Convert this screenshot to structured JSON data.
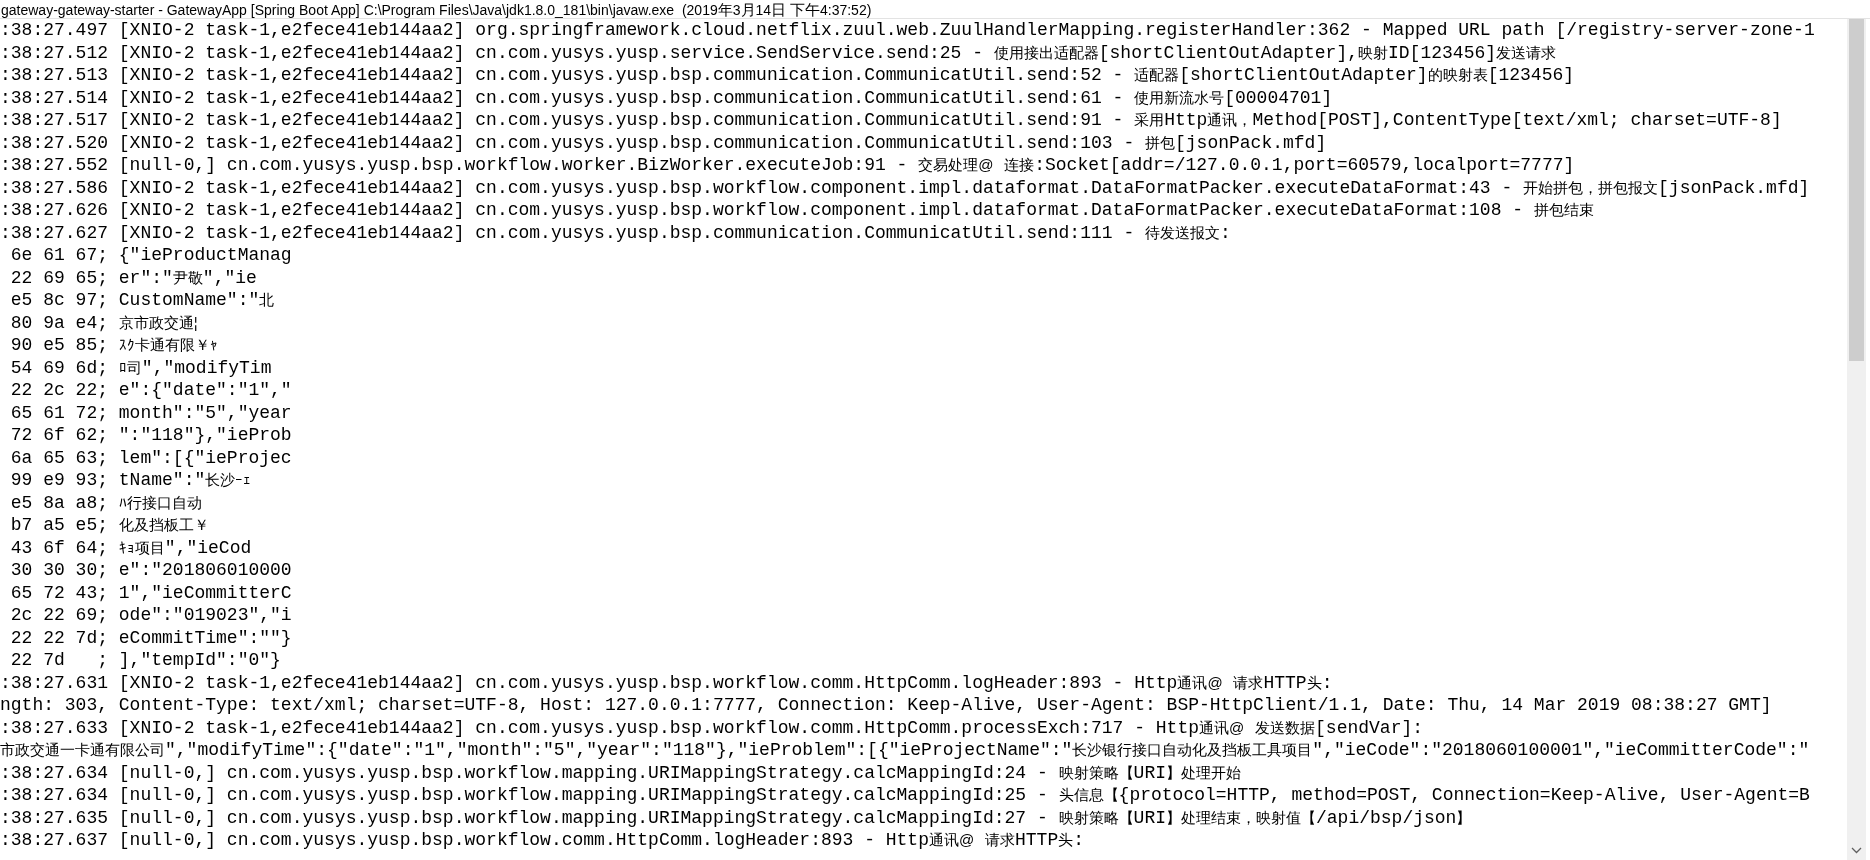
{
  "window": {
    "title": "gateway-gateway-starter - GatewayApp [Spring Boot App] C:\\Program Files\\Java\\jdk1.8.0_181\\bin\\javaw.exe  (2019年3月14日 下午4:37:52)"
  },
  "console": {
    "lines": [
      ":38:27.497 [XNIO-2 task-1,e2fece41eb144aa2] org.springframework.cloud.netflix.zuul.web.ZuulHandlerMapping.registerHandler:362 - Mapped URL path [/registry-server-zone-1",
      ":38:27.512 [XNIO-2 task-1,e2fece41eb144aa2] cn.com.yusys.yusp.service.SendService.send:25 - 使用接出适配器[shortClientOutAdapter],映射ID[123456]发送请求",
      ":38:27.513 [XNIO-2 task-1,e2fece41eb144aa2] cn.com.yusys.yusp.bsp.communication.CommunicatUtil.send:52 - 适配器[shortClientOutAdapter]的映射表[123456]",
      ":38:27.514 [XNIO-2 task-1,e2fece41eb144aa2] cn.com.yusys.yusp.bsp.communication.CommunicatUtil.send:61 - 使用新流水号[00004701]",
      ":38:27.517 [XNIO-2 task-1,e2fece41eb144aa2] cn.com.yusys.yusp.bsp.communication.CommunicatUtil.send:91 - 采用Http通讯，Method[POST],ContentType[text/xml; charset=UTF-8]",
      ":38:27.520 [XNIO-2 task-1,e2fece41eb144aa2] cn.com.yusys.yusp.bsp.communication.CommunicatUtil.send:103 - 拼包[jsonPack.mfd]",
      ":38:27.552 [null-0,] cn.com.yusys.yusp.bsp.workflow.worker.BizWorker.executeJob:91 - 交易处理@ 连接:Socket[addr=/127.0.0.1,port=60579,localport=7777]",
      ":38:27.586 [XNIO-2 task-1,e2fece41eb144aa2] cn.com.yusys.yusp.bsp.workflow.component.impl.dataformat.DataFormatPacker.executeDataFormat:43 - 开始拼包，拼包报文[jsonPack.mfd]",
      ":38:27.626 [XNIO-2 task-1,e2fece41eb144aa2] cn.com.yusys.yusp.bsp.workflow.component.impl.dataformat.DataFormatPacker.executeDataFormat:108 - 拼包结束",
      ":38:27.627 [XNIO-2 task-1,e2fece41eb144aa2] cn.com.yusys.yusp.bsp.communication.CommunicatUtil.send:111 - 待发送报文:",
      " 6e 61 67; {\"ieProductManag",
      " 22 69 65; er\":\"尹敬\",\"ie",
      " e5 8c 97; CustomName\":\"北",
      " 80 9a e4; 京市政交通¦",
      " 90 e5 85; ｽｸ卡通有限￥ｬ",
      " 54 69 6d; ﾛ司\",\"modifyTim",
      " 22 2c 22; e\":{\"date\":\"1\",\"",
      " 65 61 72; month\":\"5\",\"year",
      " 72 6f 62; \":\"118\"},\"ieProb",
      " 6a 65 63; lem\":[{\"ieProjec",
      " 99 e9 93; tName\":\"长沙ｰｪ",
      " e5 8a a8; ﾊ行接口自动",
      " b7 a5 e5; 化及挡板工￥",
      " 43 6f 64; ｷｮ项目\",\"ieCod",
      " 30 30 30; e\":\"201806010000",
      " 65 72 43; 1\",\"ieCommitterC",
      " 2c 22 69; ode\":\"019023\",\"i",
      " 22 22 7d; eCommitTime\":\"\"}",
      " 22 7d   ; ],\"tempId\":\"0\"}",
      ":38:27.631 [XNIO-2 task-1,e2fece41eb144aa2] cn.com.yusys.yusp.bsp.workflow.comm.HttpComm.logHeader:893 - Http通讯@ 请求HTTP头:",
      "ngth: 303, Content-Type: text/xml; charset=UTF-8, Host: 127.0.0.1:7777, Connection: Keep-Alive, User-Agent: BSP-HttpClient/1.1, Date: Thu, 14 Mar 2019 08:38:27 GMT]",
      ":38:27.633 [XNIO-2 task-1,e2fece41eb144aa2] cn.com.yusys.yusp.bsp.workflow.comm.HttpComm.processExch:717 - Http通讯@ 发送数据[sendVar]:",
      "市政交通一卡通有限公司\",\"modifyTime\":{\"date\":\"1\",\"month\":\"5\",\"year\":\"118\"},\"ieProblem\":[{\"ieProjectName\":\"长沙银行接口自动化及挡板工具项目\",\"ieCode\":\"2018060100001\",\"ieCommitterCode\":\"",
      ":38:27.634 [null-0,] cn.com.yusys.yusp.bsp.workflow.mapping.URIMappingStrategy.calcMappingId:24 - 映射策略【URI】处理开始",
      ":38:27.634 [null-0,] cn.com.yusys.yusp.bsp.workflow.mapping.URIMappingStrategy.calcMappingId:25 - 头信息【{protocol=HTTP, method=POST, Connection=Keep-Alive, User-Agent=B",
      ":38:27.635 [null-0,] cn.com.yusys.yusp.bsp.workflow.mapping.URIMappingStrategy.calcMappingId:27 - 映射策略【URI】处理结束，映射值【/api/bsp/json】",
      ":38:27.637 [null-0,] cn.com.yusys.yusp.bsp.workflow.comm.HttpComm.logHeader:893 - Http通讯@ 请求HTTP头:"
    ]
  }
}
